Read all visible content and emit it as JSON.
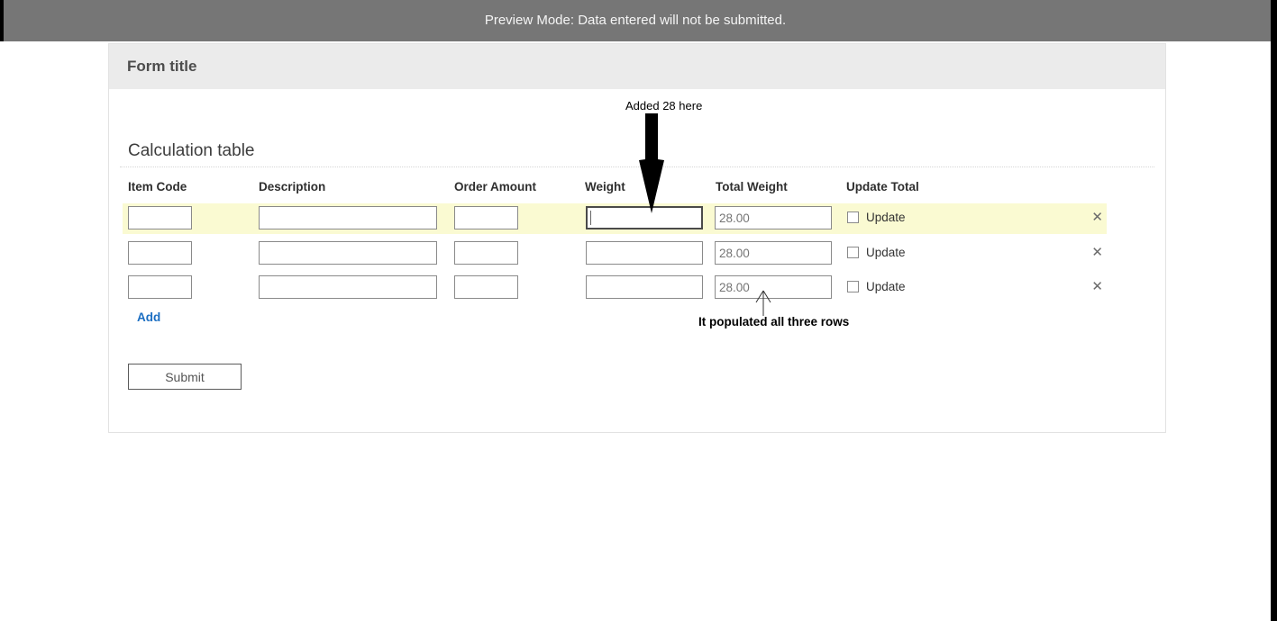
{
  "banner": {
    "text": "Preview Mode: Data entered will not be submitted."
  },
  "form": {
    "title": "Form title",
    "section_title": "Calculation table",
    "columns": {
      "item_code": "Item Code",
      "description": "Description",
      "order_amount": "Order Amount",
      "weight": "Weight",
      "total_weight": "Total Weight",
      "update_total": "Update Total"
    },
    "rows": [
      {
        "item_code": "",
        "description": "",
        "order_amount": "",
        "weight": "",
        "total_weight": "28.00",
        "update_label": "Update",
        "update_checked": false,
        "highlighted": true
      },
      {
        "item_code": "",
        "description": "",
        "order_amount": "",
        "weight": "",
        "total_weight": "28.00",
        "update_label": "Update",
        "update_checked": false,
        "highlighted": false
      },
      {
        "item_code": "",
        "description": "",
        "order_amount": "",
        "weight": "",
        "total_weight": "28.00",
        "update_label": "Update",
        "update_checked": false,
        "highlighted": false
      }
    ],
    "add_label": "Add",
    "submit_label": "Submit",
    "remove_icon": "✕"
  },
  "annotations": {
    "weight_note": "Added 28 here",
    "populated_note": "It populated all three rows"
  },
  "colors": {
    "banner_bg": "#767676",
    "header_bg": "#ebebeb",
    "row_highlight": "#fafad2",
    "link_blue": "#1b6ec2",
    "arrow_black": "#000000"
  }
}
